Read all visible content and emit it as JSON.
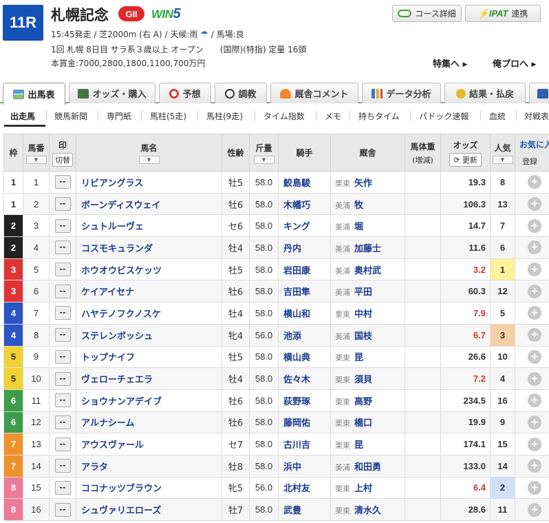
{
  "header": {
    "race_number": "11R",
    "race_name": "札幌記念",
    "grade": "GII",
    "win5_prefix": "WIN",
    "win5_suffix": "5",
    "course_button": "コース詳細",
    "ipat_logo": "IPAT",
    "ipat_button": "連携",
    "info_line1": "15:45発走 / 芝2000m (右 A) / 天候:雨",
    "weather_icon": "umbrella-icon",
    "info_line1b": "/ 馬場:良",
    "info_line2": "1回 札幌 8日目 サラ系３歳以上 オープン　　(国際)(特指) 定量 16頭",
    "info_line3": "本賞金:7000,2800,1800,1100,700万円",
    "link_feature": "特集へ",
    "link_pro": "俺プロへ"
  },
  "tabs": [
    {
      "label": "出馬表",
      "active": true
    },
    {
      "label": "オッズ・購入"
    },
    {
      "label": "予想"
    },
    {
      "label": "調教"
    },
    {
      "label": "厩舎コメント"
    },
    {
      "label": "データ分析"
    },
    {
      "label": "結果・払戻"
    }
  ],
  "subtabs": [
    "出走馬",
    "競馬新聞",
    "専門紙",
    "馬柱(5走)",
    "馬柱(9走)",
    "タイム指数",
    "メモ",
    "持ちタイム",
    "パドック速報",
    "血統",
    "対戦表"
  ],
  "table_headers": {
    "waku": "枠",
    "umaban": "馬番",
    "mark": "印",
    "mark_button": "切替",
    "horse": "馬名",
    "sex_age": "性齢",
    "weight": "斤量",
    "jockey": "騎手",
    "trainer": "厩舎",
    "body_weight": "馬体重",
    "body_weight_sub": "(増減)",
    "odds": "オッズ",
    "update_button": "更新",
    "popularity": "人気",
    "favorite": "お気に入",
    "favorite_sub": "登録"
  },
  "mark_value": "--",
  "colors": {
    "waku1": "#ffffff",
    "waku2": "#222222",
    "waku3": "#e03434",
    "waku4": "#2c56c4",
    "waku5": "#f1d233",
    "waku6": "#3e9c4a",
    "waku7": "#f0922c",
    "waku8": "#ee7a9a",
    "pop1": "#fff29a",
    "pop2": "#cfe0fb",
    "pop3": "#f8cfa4",
    "hot_odds": "#d03030"
  },
  "horses": [
    {
      "waku": "1",
      "num": "1",
      "name": "リビアングラス",
      "sex": "牡5",
      "weight": "58.0",
      "jockey": "鮫島駿",
      "area": "栗東",
      "trainer": "矢作",
      "odds": "19.3",
      "pop": "8"
    },
    {
      "waku": "1",
      "num": "2",
      "name": "ボーンディスウェイ",
      "sex": "牡6",
      "weight": "58.0",
      "jockey": "木幡巧",
      "area": "美浦",
      "trainer": "牧",
      "odds": "106.3",
      "pop": "13"
    },
    {
      "waku": "2",
      "num": "3",
      "name": "シュトルーヴェ",
      "sex": "セ6",
      "weight": "58.0",
      "jockey": "キング",
      "area": "美浦",
      "trainer": "堀",
      "odds": "14.7",
      "pop": "7"
    },
    {
      "waku": "2",
      "num": "4",
      "name": "コスモキュランダ",
      "sex": "牡4",
      "weight": "58.0",
      "jockey": "丹内",
      "area": "美浦",
      "trainer": "加藤士",
      "odds": "11.6",
      "pop": "6"
    },
    {
      "waku": "3",
      "num": "5",
      "name": "ホウオウビスケッツ",
      "sex": "牡5",
      "weight": "58.0",
      "jockey": "岩田康",
      "area": "美浦",
      "trainer": "奥村武",
      "odds": "3.2",
      "pop": "1"
    },
    {
      "waku": "3",
      "num": "6",
      "name": "ケイアイセナ",
      "sex": "牡6",
      "weight": "58.0",
      "jockey": "吉田隼",
      "area": "美浦",
      "trainer": "平田",
      "odds": "60.3",
      "pop": "12"
    },
    {
      "waku": "4",
      "num": "7",
      "name": "ハヤテノフクノスケ",
      "sex": "牡4",
      "weight": "58.0",
      "jockey": "横山和",
      "area": "栗東",
      "trainer": "中村",
      "odds": "7.9",
      "pop": "5"
    },
    {
      "waku": "4",
      "num": "8",
      "name": "ステレンボッシュ",
      "sex": "牝4",
      "weight": "56.0",
      "jockey": "池添",
      "area": "美浦",
      "trainer": "国枝",
      "odds": "6.7",
      "pop": "3"
    },
    {
      "waku": "5",
      "num": "9",
      "name": "トップナイフ",
      "sex": "牡5",
      "weight": "58.0",
      "jockey": "横山典",
      "area": "栗東",
      "trainer": "昆",
      "odds": "26.6",
      "pop": "10"
    },
    {
      "waku": "5",
      "num": "10",
      "name": "ヴェローチェエラ",
      "sex": "牡4",
      "weight": "58.0",
      "jockey": "佐々木",
      "area": "栗東",
      "trainer": "須貝",
      "odds": "7.2",
      "pop": "4"
    },
    {
      "waku": "6",
      "num": "11",
      "name": "ショウナンアデイブ",
      "sex": "牡6",
      "weight": "58.0",
      "jockey": "荻野琢",
      "area": "栗東",
      "trainer": "高野",
      "odds": "234.5",
      "pop": "16"
    },
    {
      "waku": "6",
      "num": "12",
      "name": "アルナシーム",
      "sex": "牡6",
      "weight": "58.0",
      "jockey": "藤岡佑",
      "area": "栗東",
      "trainer": "橋口",
      "odds": "19.9",
      "pop": "9"
    },
    {
      "waku": "7",
      "num": "13",
      "name": "アウスヴァール",
      "sex": "セ7",
      "weight": "58.0",
      "jockey": "古川吉",
      "area": "栗東",
      "trainer": "昆",
      "odds": "174.1",
      "pop": "15"
    },
    {
      "waku": "7",
      "num": "14",
      "name": "アラタ",
      "sex": "牡8",
      "weight": "58.0",
      "jockey": "浜中",
      "area": "美浦",
      "trainer": "和田勇",
      "odds": "133.0",
      "pop": "14"
    },
    {
      "waku": "8",
      "num": "15",
      "name": "ココナッツブラウン",
      "sex": "牝5",
      "weight": "56.0",
      "jockey": "北村友",
      "area": "栗東",
      "trainer": "上村",
      "odds": "6.4",
      "pop": "2"
    },
    {
      "waku": "8",
      "num": "16",
      "name": "シュヴァリエローズ",
      "sex": "牡7",
      "weight": "58.0",
      "jockey": "武豊",
      "area": "栗東",
      "trainer": "清水久",
      "odds": "28.6",
      "pop": "11"
    }
  ]
}
